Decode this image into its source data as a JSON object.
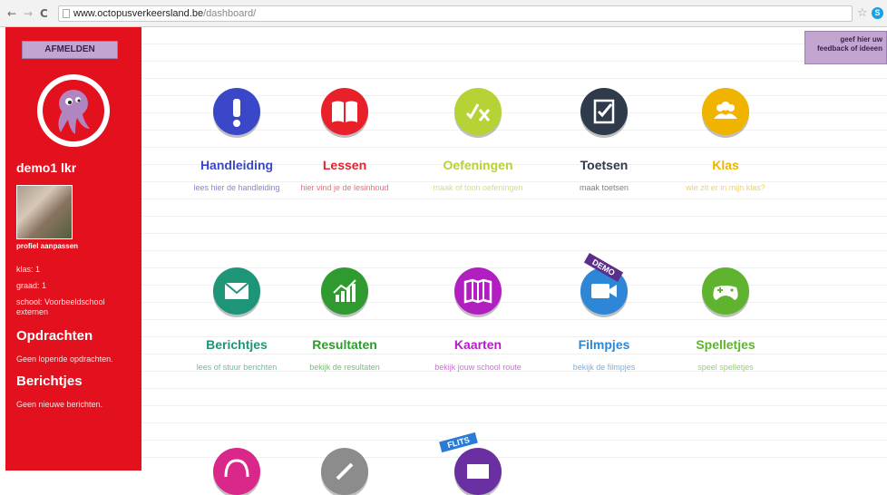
{
  "browser": {
    "back": "←",
    "forward": "→",
    "reload": "C",
    "url_host": "www.octopusverkeersland.be",
    "url_path": "/dashboard/",
    "star": "☆",
    "ext": "S"
  },
  "sidebar": {
    "logout_label": "AFMELDEN",
    "username": "demo1 lkr",
    "profile_link": "profiel aanpassen",
    "klas": "klas: 1",
    "graad": "graad: 1",
    "school": "school: Voorbeeldschool externen",
    "opdrachten_title": "Opdrachten",
    "opdrachten_sub": "Geen lopende opdrachten.",
    "berichtjes_title": "Berichtjes",
    "berichtjes_sub": "Geen nieuwe berichten."
  },
  "feedback": {
    "line1": "geef hier uw",
    "line2": "feedback of ideeen"
  },
  "tiles": [
    {
      "title": "Handleiding",
      "sub": "lees hier de handleiding",
      "color": "#3a47c8",
      "icon": "exclamation-icon"
    },
    {
      "title": "Lessen",
      "sub": "hier vind je de lesinhoud",
      "color": "#e8202a",
      "icon": "book-icon"
    },
    {
      "title": "Oefeningen",
      "sub": "maak of toon oefeningen",
      "color": "#b5d334",
      "icon": "check-x-icon"
    },
    {
      "title": "Toetsen",
      "sub": "maak toetsen",
      "color": "#2f3a4a",
      "icon": "test-icon"
    },
    {
      "title": "Klas",
      "sub": "wie zit er in mijn klas?",
      "color": "#f0b400",
      "icon": "people-icon"
    },
    {
      "title": "Berichtjes",
      "sub": "lees of stuur berichten",
      "color": "#1e9577",
      "icon": "envelope-icon"
    },
    {
      "title": "Resultaten",
      "sub": "bekijk de resultaten",
      "color": "#2f9a2f",
      "icon": "chart-icon"
    },
    {
      "title": "Kaarten",
      "sub": "bekijk jouw school route",
      "color": "#b11fc0",
      "icon": "map-icon"
    },
    {
      "title": "Filmpjes",
      "sub": "bekijk de filmpjes",
      "color": "#2e86d6",
      "icon": "camera-icon",
      "ribbon": "DEMO"
    },
    {
      "title": "Spelletjes",
      "sub": "speel spelletjes",
      "color": "#5fb32e",
      "icon": "gamepad-icon"
    }
  ],
  "bottom_tiles": [
    {
      "color": "#d9288a",
      "icon": "headset-icon"
    },
    {
      "color": "#8c8c8c",
      "icon": "pen-icon"
    },
    {
      "color": "#6a2fa0",
      "icon": "flits-icon",
      "ribbon": "FLITS"
    }
  ]
}
